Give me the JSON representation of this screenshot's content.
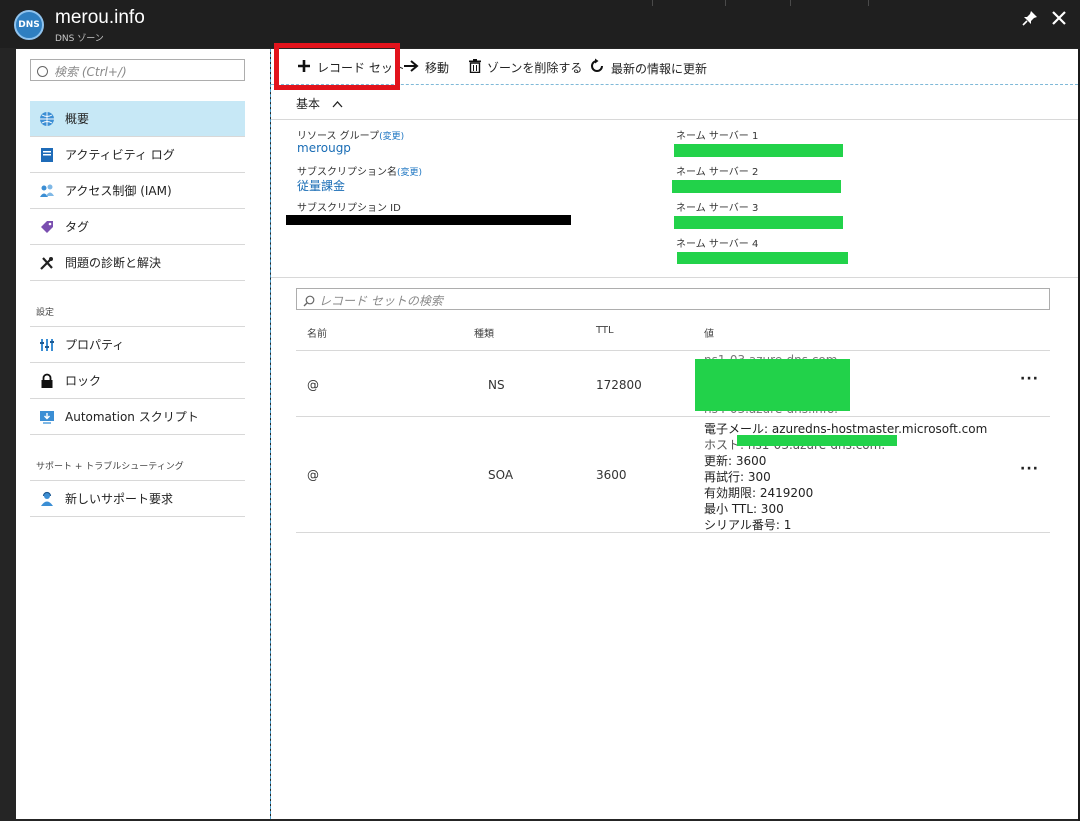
{
  "window": {
    "logo_text": "DNS",
    "title": "merou.info",
    "subtitle": "DNS ゾーン",
    "pin_glyph": "📌",
    "close_glyph": "✕"
  },
  "sidebar": {
    "search_placeholder": "検索 (Ctrl+/)",
    "items": [
      {
        "label": "概要",
        "icon": "globe-icon"
      },
      {
        "label": "アクティビティ ログ",
        "icon": "log-icon"
      },
      {
        "label": "アクセス制御 (IAM)",
        "icon": "people-icon"
      },
      {
        "label": "タグ",
        "icon": "tag-icon"
      },
      {
        "label": "問題の診断と解決",
        "icon": "wrench-icon"
      }
    ],
    "group_settings": "設定",
    "settings_items": [
      {
        "label": "プロパティ",
        "icon": "properties-icon"
      },
      {
        "label": "ロック",
        "icon": "lock-icon"
      },
      {
        "label": "Automation スクリプト",
        "icon": "download-icon"
      }
    ],
    "group_support": "サポート + トラブルシューティング",
    "support_items": [
      {
        "label": "新しいサポート要求",
        "icon": "support-person-icon"
      }
    ]
  },
  "toolbar": {
    "add_record_set": "レコード セット",
    "move": "移動",
    "delete_zone": "ゾーンを削除する",
    "refresh": "最新の情報に更新"
  },
  "essentials": {
    "header": "基本",
    "resource_group_label": "リソース グループ",
    "change_label": "(変更)",
    "resource_group_value": "merougp",
    "subscription_name_label": "サブスクリプション名",
    "subscription_name_value": "従量課金",
    "subscription_id_label": "サブスクリプション ID",
    "name_server_1": "ネーム サーバー 1",
    "name_server_2": "ネーム サーバー 2",
    "name_server_3": "ネーム サーバー 3",
    "name_server_4": "ネーム サーバー 4"
  },
  "records": {
    "search_placeholder": "レコード セットの検索",
    "columns": [
      "名前",
      "種類",
      "TTL",
      "値"
    ],
    "rows": [
      {
        "name": "@",
        "type": "NS",
        "ttl": "172800",
        "value_top": "ns1-03.azure-dns.com.",
        "value_bottom": "ns4-03.azure-dns.info."
      },
      {
        "name": "@",
        "type": "SOA",
        "ttl": "3600",
        "value_lines": [
          "電子メール: azuredns-hostmaster.microsoft.com",
          "ホスト: ns1-03.azure-dns.com.",
          "更新: 3600",
          "再試行: 300",
          "有効期限: 2419200",
          "最小 TTL: 300",
          "シリアル番号: 1"
        ]
      }
    ],
    "more_glyph": "···"
  },
  "colors": {
    "accent": "#1a6db5",
    "selected": "#c7e8f6",
    "highlight_box": "#e2131c",
    "redaction_green": "#22d24a"
  }
}
